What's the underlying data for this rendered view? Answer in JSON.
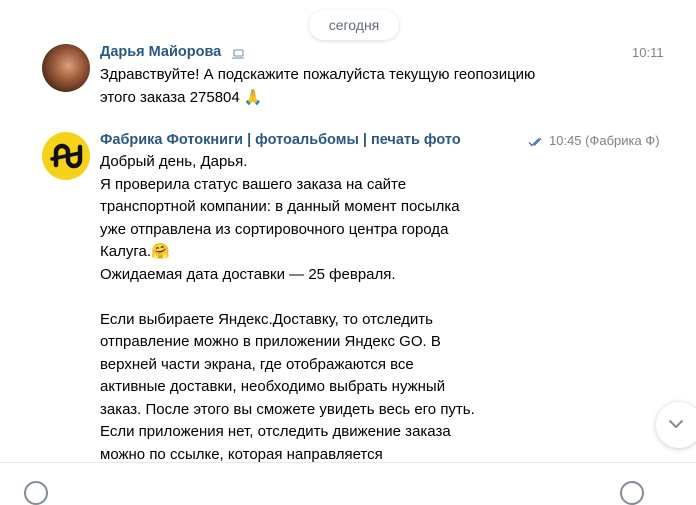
{
  "date_separator": "сегодня",
  "messages": [
    {
      "sender": "Дарья Майорова",
      "time": "10:11",
      "lines": [
        "Здравствуйте! А подскажите пожалуйста текущую геопозицию",
        "этого заказа 275804 🙏"
      ]
    },
    {
      "sender": "Фабрика Фотокниги | фотоальбомы | печать фото",
      "time": "10:45 (Фабрика Ф)",
      "lines": [
        "Добрый день, Дарья.",
        "Я проверила статус вашего заказа на сайте",
        "транспортной компании: в данный момент посылка",
        "уже отправлена из сортировочного центра города",
        "Калуга.🤗",
        "Ожидаемая дата доставки — 25 февраля.",
        "",
        "Если выбираете Яндекс.Доставку, то отследить",
        "отправление можно в приложении Яндекс GO. В",
        "верхней части экрана, где отображаются все",
        "активные доставки, необходимо выбрать нужный",
        "заказ. После этого вы сможете увидеть весь его путь.",
        "Если приложения нет, отследить движение заказа",
        "можно по ссылке, которая направляется"
      ]
    }
  ],
  "colors": {
    "link": "#2a5885",
    "meta": "#828282",
    "read_check": "#4a76a8",
    "brand_yellow": "#f7d21a"
  }
}
